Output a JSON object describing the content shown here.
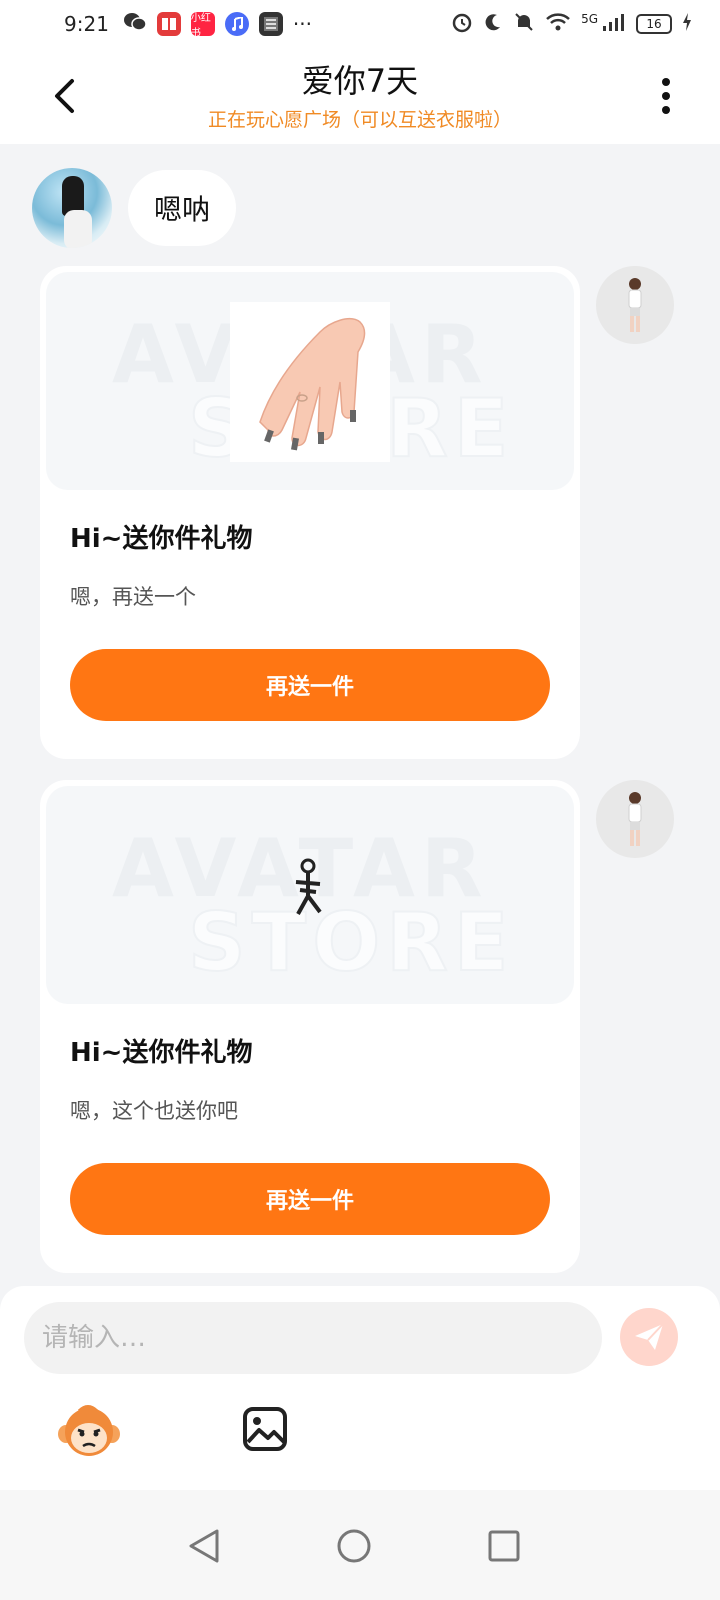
{
  "status_bar": {
    "time": "9:21",
    "network": "5G",
    "battery": "16",
    "app_label_red": "小红书"
  },
  "header": {
    "title": "爱你7天",
    "subtitle": "正在玩心愿广场（可以互送衣服啦）"
  },
  "messages": {
    "incoming_text": "嗯呐",
    "gifts": [
      {
        "title": "Hi~送你件礼物",
        "desc": "嗯，再送一个",
        "button": "再送一件",
        "watermark_top": "AVATAR",
        "watermark_bottom": "STORE",
        "item": "hand-icon"
      },
      {
        "title": "Hi~送你件礼物",
        "desc": "嗯，这个也送你吧",
        "button": "再送一件",
        "watermark_top": "AVATAR",
        "watermark_bottom": "STORE",
        "item": "figure-icon"
      }
    ]
  },
  "composer": {
    "placeholder": "请输入…",
    "accent": "#ff7613",
    "send_color": "#ffd6cc"
  },
  "colors": {
    "subtitle": "#f08a24",
    "button": "#ff7613",
    "page_bg": "#f3f4f6"
  }
}
